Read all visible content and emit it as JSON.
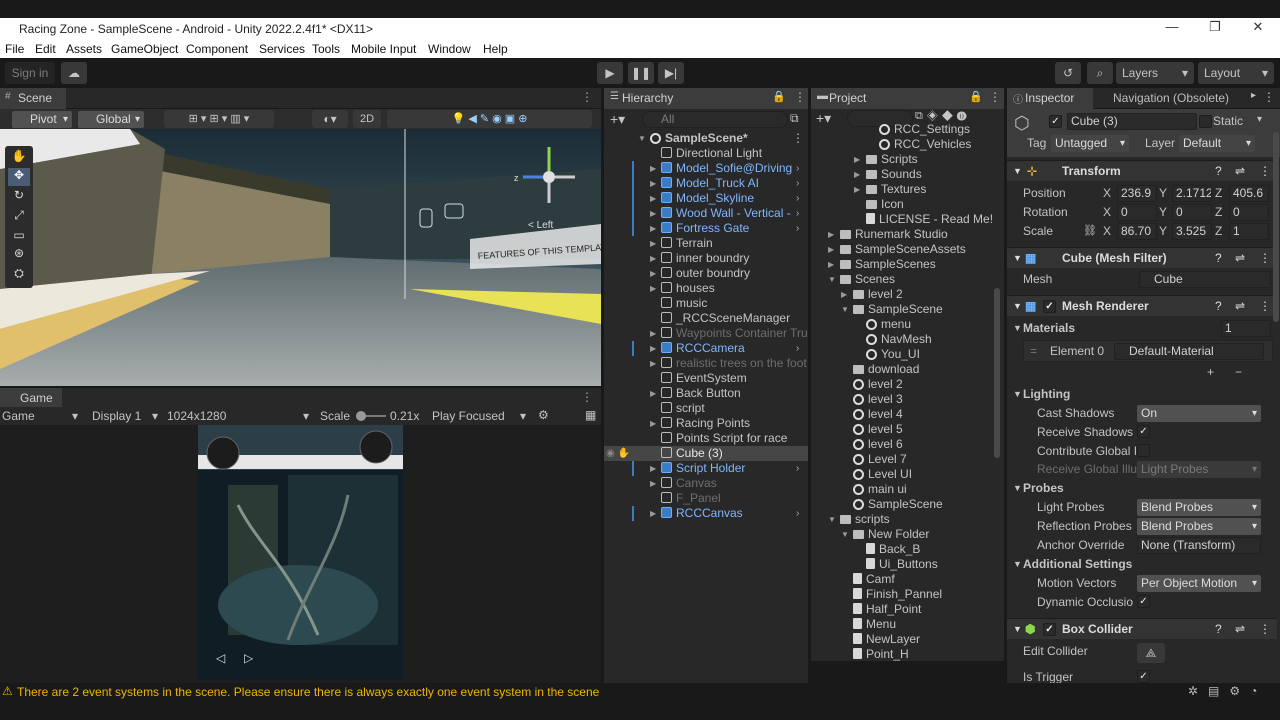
{
  "window": {
    "title": "Racing Zone - SampleScene - Android - Unity 2022.2.4f1* <DX11>",
    "minimize": "—",
    "restore": "❐",
    "close": "✕"
  },
  "menu": [
    "File",
    "Edit",
    "Assets",
    "GameObject",
    "Component",
    "Services",
    "Tools",
    "Mobile Input",
    "Window",
    "Help"
  ],
  "toolbar": {
    "sign_in": "Sign in",
    "layers": "Layers",
    "layout": "Layout"
  },
  "scene": {
    "tab": "Scene",
    "pivot": "Pivot",
    "global": "Global",
    "mode2d": "2D",
    "gizmo_left": "< Left",
    "banner": "FEATURES OF THIS TEMPLATE"
  },
  "game": {
    "tab": "Game",
    "mode": "Game",
    "display": "Display 1",
    "resolution": "1024x1280",
    "scale_label": "Scale",
    "scale_value": "0.21x",
    "play_focused": "Play Focused"
  },
  "hierarchy": {
    "tab": "Hierarchy",
    "search_placeholder": "All",
    "scene_name": "SampleScene*",
    "items": [
      {
        "label": "Directional Light",
        "style": "normal",
        "expand": false
      },
      {
        "label": "Model_Sofie@Driving",
        "style": "blue",
        "expand": true
      },
      {
        "label": "Model_Truck AI",
        "style": "blue",
        "expand": true
      },
      {
        "label": "Model_Skyline",
        "style": "blue",
        "expand": true
      },
      {
        "label": "Wood Wall - Vertical -",
        "style": "blue",
        "expand": true
      },
      {
        "label": "Fortress Gate",
        "style": "blue",
        "expand": true
      },
      {
        "label": "Terrain",
        "style": "normal",
        "expand": true
      },
      {
        "label": "inner boundry",
        "style": "normal",
        "expand": true
      },
      {
        "label": "outer boundry",
        "style": "normal",
        "expand": true
      },
      {
        "label": "houses",
        "style": "normal",
        "expand": true
      },
      {
        "label": "music",
        "style": "normal",
        "expand": false
      },
      {
        "label": "_RCCSceneManager",
        "style": "normal",
        "expand": false
      },
      {
        "label": "Waypoints Container Tru",
        "style": "dim",
        "expand": true
      },
      {
        "label": "RCCCamera",
        "style": "blue",
        "expand": true
      },
      {
        "label": "realistic trees on the foot",
        "style": "dim",
        "expand": true
      },
      {
        "label": "EventSystem",
        "style": "normal",
        "expand": false
      },
      {
        "label": "Back Button",
        "style": "normal",
        "expand": true
      },
      {
        "label": "script",
        "style": "normal",
        "expand": false
      },
      {
        "label": "Racing Points",
        "style": "normal",
        "expand": true
      },
      {
        "label": "Points Script for race",
        "style": "normal",
        "expand": false
      },
      {
        "label": "Cube (3)",
        "style": "selected",
        "expand": false
      },
      {
        "label": "Script Holder",
        "style": "blue",
        "expand": true
      },
      {
        "label": "Canvas",
        "style": "dim",
        "expand": true
      },
      {
        "label": "F_Panel",
        "style": "dim",
        "expand": false
      },
      {
        "label": "RCCCanvas",
        "style": "blue",
        "expand": true
      }
    ]
  },
  "project": {
    "tab": "Project",
    "items": [
      {
        "label": "RCC_Settings",
        "indent": 4,
        "icon": "unity",
        "expand": ""
      },
      {
        "label": "RCC_Vehicles",
        "indent": 4,
        "icon": "unity",
        "expand": ""
      },
      {
        "label": "Scripts",
        "indent": 3,
        "icon": "folder",
        "expand": "▶"
      },
      {
        "label": "Sounds",
        "indent": 3,
        "icon": "folder",
        "expand": "▶"
      },
      {
        "label": "Textures",
        "indent": 3,
        "icon": "folder",
        "expand": "▶"
      },
      {
        "label": "Icon",
        "indent": 3,
        "icon": "folder",
        "expand": ""
      },
      {
        "label": "LICENSE - Read Me!",
        "indent": 3,
        "icon": "script",
        "expand": ""
      },
      {
        "label": "Runemark Studio",
        "indent": 1,
        "icon": "folder",
        "expand": "▶"
      },
      {
        "label": "SampleSceneAssets",
        "indent": 1,
        "icon": "folder",
        "expand": "▶"
      },
      {
        "label": "SampleScenes",
        "indent": 1,
        "icon": "folder",
        "expand": "▶"
      },
      {
        "label": "Scenes",
        "indent": 1,
        "icon": "folder",
        "expand": "▼"
      },
      {
        "label": "level 2",
        "indent": 2,
        "icon": "folder",
        "expand": "▶"
      },
      {
        "label": "SampleScene",
        "indent": 2,
        "icon": "folder",
        "expand": "▼"
      },
      {
        "label": "menu",
        "indent": 3,
        "icon": "unity",
        "expand": ""
      },
      {
        "label": "NavMesh",
        "indent": 3,
        "icon": "unity",
        "expand": ""
      },
      {
        "label": "You_UI",
        "indent": 3,
        "icon": "unity",
        "expand": ""
      },
      {
        "label": "download",
        "indent": 2,
        "icon": "folder",
        "expand": ""
      },
      {
        "label": "level 2",
        "indent": 2,
        "icon": "unity",
        "expand": ""
      },
      {
        "label": "level 3",
        "indent": 2,
        "icon": "unity",
        "expand": ""
      },
      {
        "label": "level 4",
        "indent": 2,
        "icon": "unity",
        "expand": ""
      },
      {
        "label": "level 5",
        "indent": 2,
        "icon": "unity",
        "expand": ""
      },
      {
        "label": "level 6",
        "indent": 2,
        "icon": "unity",
        "expand": ""
      },
      {
        "label": "Level 7",
        "indent": 2,
        "icon": "unity",
        "expand": ""
      },
      {
        "label": "Level UI",
        "indent": 2,
        "icon": "unity",
        "expand": ""
      },
      {
        "label": "main ui",
        "indent": 2,
        "icon": "unity",
        "expand": ""
      },
      {
        "label": "SampleScene",
        "indent": 2,
        "icon": "unity",
        "expand": ""
      },
      {
        "label": "scripts",
        "indent": 1,
        "icon": "folder",
        "expand": "▼"
      },
      {
        "label": "New Folder",
        "indent": 2,
        "icon": "folder",
        "expand": "▼"
      },
      {
        "label": "Back_B",
        "indent": 3,
        "icon": "script",
        "expand": ""
      },
      {
        "label": "Ui_Buttons",
        "indent": 3,
        "icon": "script",
        "expand": ""
      },
      {
        "label": "Camf",
        "indent": 2,
        "icon": "script",
        "expand": ""
      },
      {
        "label": "Finish_Pannel",
        "indent": 2,
        "icon": "script",
        "expand": ""
      },
      {
        "label": "Half_Point",
        "indent": 2,
        "icon": "script",
        "expand": ""
      },
      {
        "label": "Menu",
        "indent": 2,
        "icon": "script",
        "expand": ""
      },
      {
        "label": "NewLayer",
        "indent": 2,
        "icon": "script",
        "expand": ""
      },
      {
        "label": "Point_H",
        "indent": 2,
        "icon": "script",
        "expand": ""
      }
    ]
  },
  "inspector": {
    "tab": "Inspector",
    "tab2": "Navigation (Obsolete)",
    "object_name": "Cube (3)",
    "static_label": "Static",
    "tag_label": "Tag",
    "tag_value": "Untagged",
    "layer_label": "Layer",
    "layer_value": "Default",
    "transform": {
      "title": "Transform",
      "position_label": "Position",
      "rotation_label": "Rotation",
      "scale_label": "Scale",
      "position": {
        "x": "236.9",
        "y": "2.1712",
        "z": "405.6"
      },
      "rotation": {
        "x": "0",
        "y": "0",
        "z": "0"
      },
      "scale": {
        "x": "86.70",
        "y": "3.525",
        "z": "1"
      }
    },
    "mesh_filter": {
      "title": "Cube (Mesh Filter)",
      "mesh_label": "Mesh",
      "mesh_value": "Cube"
    },
    "mesh_renderer": {
      "title": "Mesh Renderer",
      "materials_label": "Materials",
      "materials_count": "1",
      "element0_label": "Element 0",
      "element0_value": "Default-Material",
      "lighting_label": "Lighting",
      "cast_shadows_label": "Cast Shadows",
      "cast_shadows_value": "On",
      "receive_shadows_label": "Receive Shadows",
      "contribute_gi_label": "Contribute Global I",
      "receive_gi_label": "Receive Global Illu",
      "receive_gi_value": "Light Probes",
      "probes_label": "Probes",
      "light_probes_label": "Light Probes",
      "light_probes_value": "Blend Probes",
      "reflection_probes_label": "Reflection Probes",
      "reflection_probes_value": "Blend Probes",
      "anchor_override_label": "Anchor Override",
      "anchor_override_value": "None (Transform)",
      "additional_label": "Additional Settings",
      "motion_vectors_label": "Motion Vectors",
      "motion_vectors_value": "Per Object Motion",
      "dynamic_occlusion_label": "Dynamic Occlusio"
    },
    "box_collider": {
      "title": "Box Collider",
      "edit_collider_label": "Edit Collider",
      "is_trigger_label": "Is Trigger"
    }
  },
  "status": {
    "message": "There are 2 event systems in the scene. Please ensure there is always exactly one event system in the scene"
  },
  "colors": {
    "accent_blue": "#7fb6ff",
    "warning": "#f0b400",
    "panel": "#282828",
    "selected_row": "#464646"
  }
}
